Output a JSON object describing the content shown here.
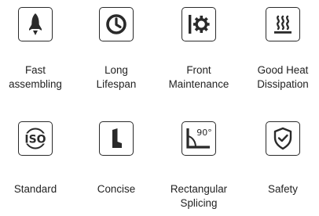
{
  "features": [
    {
      "icon": "rocket-icon",
      "lines": [
        "Fast",
        "assembling"
      ]
    },
    {
      "icon": "clock-icon",
      "lines": [
        "Long",
        "Lifespan"
      ]
    },
    {
      "icon": "front-maintenance-gear-icon",
      "lines": [
        "Front",
        "Maintenance"
      ]
    },
    {
      "icon": "heat-dissipation-icon",
      "lines": [
        "Good Heat",
        "Dissipation"
      ]
    },
    {
      "icon": "iso-standard-icon",
      "lines": [
        "Standard"
      ]
    },
    {
      "icon": "l-profile-icon",
      "lines": [
        "Concise"
      ]
    },
    {
      "icon": "right-angle-icon",
      "lines": [
        "Rectangular",
        "Splicing"
      ]
    },
    {
      "icon": "shield-check-icon",
      "lines": [
        "Safety"
      ]
    }
  ],
  "icon_texts": {
    "iso": "ISO",
    "angle": "90°"
  },
  "colors": {
    "icon_stroke": "#2a2a2a",
    "text": "#222222",
    "background": "#ffffff"
  }
}
